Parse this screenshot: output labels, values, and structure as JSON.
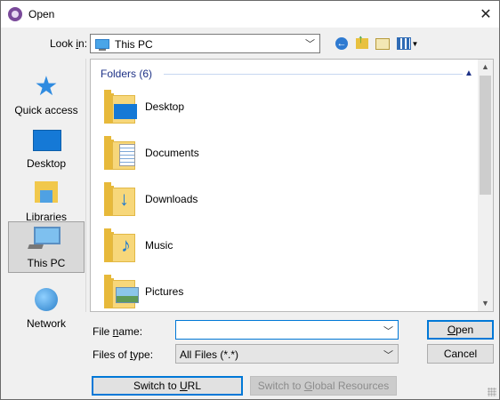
{
  "window": {
    "title": "Open",
    "close_glyph": "✕"
  },
  "look_in": {
    "label_pre": "Look ",
    "label_key": "i",
    "label_post": "n:",
    "value": "This PC"
  },
  "toolbar": {
    "icons": [
      "back-icon",
      "up-folder-icon",
      "new-folder-icon",
      "view-menu-icon"
    ]
  },
  "places": [
    {
      "label": "Quick access",
      "icon": "star-icon",
      "selected": false
    },
    {
      "label": "Desktop",
      "icon": "desktop-icon",
      "selected": false
    },
    {
      "label": "Libraries",
      "icon": "libraries-icon",
      "selected": false
    },
    {
      "label": "This PC",
      "icon": "computer-icon",
      "selected": true
    },
    {
      "label": "Network",
      "icon": "network-icon",
      "selected": false
    }
  ],
  "group": {
    "header": "Folders (6)"
  },
  "items": [
    {
      "name": "Desktop",
      "icon": "desktop-folder-icon"
    },
    {
      "name": "Documents",
      "icon": "documents-folder-icon"
    },
    {
      "name": "Downloads",
      "icon": "downloads-folder-icon"
    },
    {
      "name": "Music",
      "icon": "music-folder-icon"
    },
    {
      "name": "Pictures",
      "icon": "pictures-folder-icon"
    }
  ],
  "form": {
    "file_name": {
      "label_pre": "File ",
      "label_key": "n",
      "label_post": "ame:",
      "value": ""
    },
    "file_type": {
      "label_pre": "Files of ",
      "label_key": "t",
      "label_post": "ype:",
      "value": "All Files (*.*)"
    }
  },
  "buttons": {
    "open": {
      "label_key": "O",
      "label_post": "pen"
    },
    "cancel": "Cancel",
    "switch_url": {
      "label_pre": "Switch to ",
      "label_key": "U",
      "label_post": "RL"
    },
    "switch_global": {
      "label_pre": "Switch to ",
      "label_key": "G",
      "label_post": "lobal Resources"
    }
  },
  "colors": {
    "accent": "#0078d7",
    "group_header": "#1e3287",
    "folder": "#f7d77a"
  }
}
